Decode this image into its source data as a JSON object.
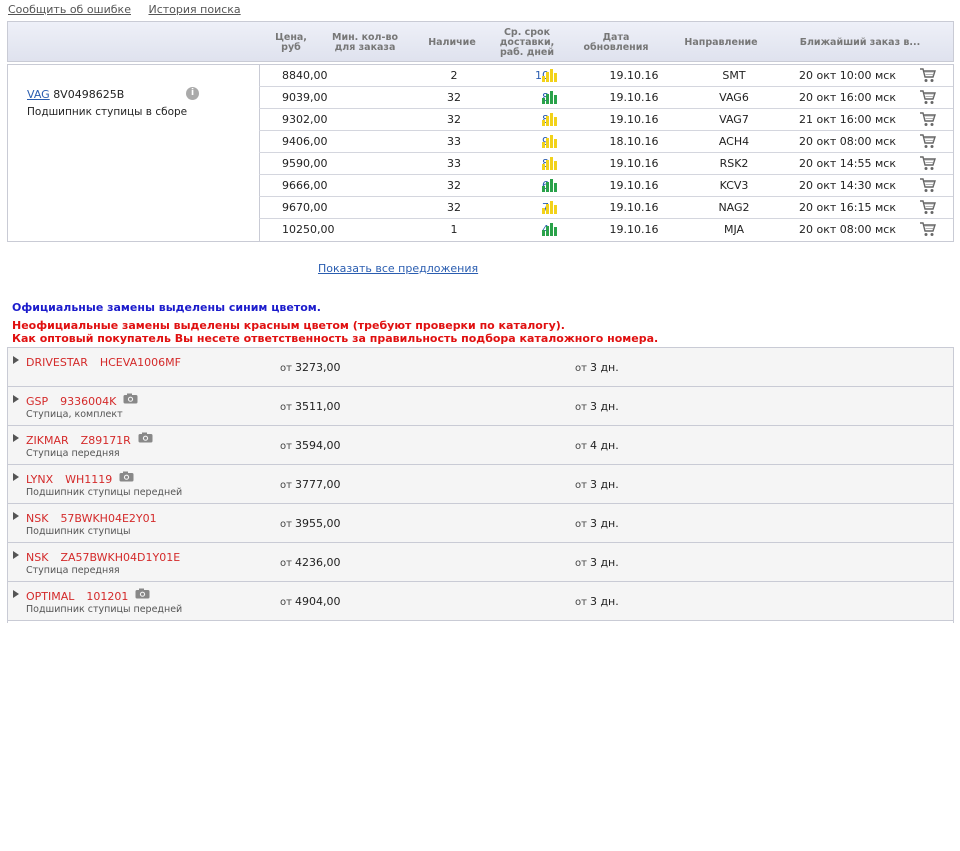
{
  "toplinks": {
    "report_error": "Сообщить об ошибке",
    "search_history": "История поиска"
  },
  "headers": {
    "price": "Цена, руб",
    "min_qty": "Мин. кол-во для заказа",
    "availability": "Наличие",
    "delivery": "Ср. срок доставки, раб. дней",
    "update_date": "Дата обновления",
    "direction": "Направление",
    "nearest": "Ближайший заказ в..."
  },
  "part": {
    "brand": "VAG",
    "number": "8V0498625B",
    "description": "Подшипник ступицы в сборе",
    "info_icon": "i"
  },
  "offers": [
    {
      "price": "8840,00",
      "qty": "2",
      "days": "10",
      "bar_color": "yellow",
      "date": "19.10.16",
      "direction": "SMT",
      "nearest": "20 окт 10:00 мск"
    },
    {
      "price": "9039,00",
      "qty": "32",
      "days": "8",
      "bar_color": "green",
      "date": "19.10.16",
      "direction": "VAG6",
      "nearest": "20 окт 16:00 мск"
    },
    {
      "price": "9302,00",
      "qty": "32",
      "days": "8",
      "bar_color": "yellow",
      "date": "19.10.16",
      "direction": "VAG7",
      "nearest": "21 окт 16:00 мск"
    },
    {
      "price": "9406,00",
      "qty": "33",
      "days": "9",
      "bar_color": "yellow",
      "date": "18.10.16",
      "direction": "ACH4",
      "nearest": "20 окт 08:00 мск"
    },
    {
      "price": "9590,00",
      "qty": "33",
      "days": "8",
      "bar_color": "yellow",
      "date": "19.10.16",
      "direction": "RSK2",
      "nearest": "20 окт 14:55 мск"
    },
    {
      "price": "9666,00",
      "qty": "32",
      "days": "6",
      "bar_color": "green",
      "date": "19.10.16",
      "direction": "KCV3",
      "nearest": "20 окт 14:30 мск"
    },
    {
      "price": "9670,00",
      "qty": "32",
      "days": "7",
      "bar_color": "yellow",
      "date": "19.10.16",
      "direction": "NAG2",
      "nearest": "20 окт 16:15 мск"
    },
    {
      "price": "10250,00",
      "qty": "1",
      "days": "4",
      "bar_color": "green",
      "date": "19.10.16",
      "direction": "MJA",
      "nearest": "20 окт 08:00 мск"
    }
  ],
  "show_all": "Показать все предложения",
  "notes": {
    "official": "Официальные замены выделены синим цветом.",
    "unofficial": "Неофициальные замены выделены красным цветом (требуют проверки по каталогу).",
    "wholesale": "Как оптовый покупатель Вы несете ответственность за правильность подбора каталожного номера."
  },
  "replacements": [
    {
      "brand": "DRIVESTAR",
      "code": "HCEVA1006MF",
      "desc": "",
      "camera": false,
      "price_prefix": "от",
      "price": "3273,00",
      "term_prefix": "от",
      "term": "3 дн."
    },
    {
      "brand": "GSP",
      "code": "9336004K",
      "desc": "Ступица, комплект",
      "camera": true,
      "price_prefix": "от",
      "price": "3511,00",
      "term_prefix": "от",
      "term": "3 дн."
    },
    {
      "brand": "ZIKMAR",
      "code": "Z89171R",
      "desc": "Ступица передняя",
      "camera": true,
      "price_prefix": "от",
      "price": "3594,00",
      "term_prefix": "от",
      "term": "4 дн."
    },
    {
      "brand": "LYNX",
      "code": "WH1119",
      "desc": "Подшипник ступицы передней",
      "camera": true,
      "price_prefix": "от",
      "price": "3777,00",
      "term_prefix": "от",
      "term": "3 дн."
    },
    {
      "brand": "NSK",
      "code": "57BWKH04E2Y01",
      "desc": "Подшипник ступицы",
      "camera": false,
      "price_prefix": "от",
      "price": "3955,00",
      "term_prefix": "от",
      "term": "3 дн."
    },
    {
      "brand": "NSK",
      "code": "ZA57BWKH04D1Y01E",
      "desc": "Ступица передняя",
      "camera": false,
      "price_prefix": "от",
      "price": "4236,00",
      "term_prefix": "от",
      "term": "3 дн."
    },
    {
      "brand": "OPTIMAL",
      "code": "101201",
      "desc": "Подшипник ступицы передней",
      "camera": true,
      "price_prefix": "от",
      "price": "4904,00",
      "term_prefix": "от",
      "term": "3 дн."
    }
  ],
  "colors": {
    "bar_yellow": "#f2d21a",
    "bar_green": "#2aa24a",
    "official": "#1c1ccc",
    "unofficial": "#e01010",
    "link": "#2a5db0"
  }
}
